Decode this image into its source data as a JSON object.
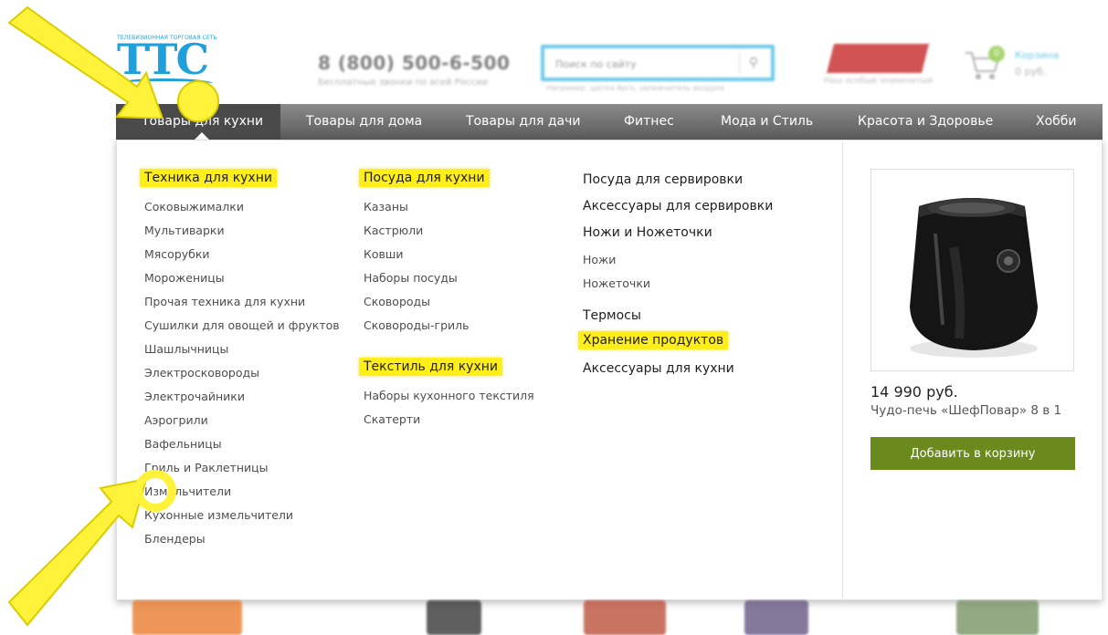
{
  "header": {
    "logo_tagline": "ТЕЛЕВИЗИОННАЯ ТОРГОВАЯ СЕТЬ",
    "logo_text": "ТТС",
    "phone": "8 (800) 500-6-500",
    "phone_note": "Бесплатные звонки по всей России",
    "search_placeholder": "Поиск по сайту",
    "search_example": "Например: щетка Арго, увлажнитель воздуха",
    "promo_note": "Наш особый знаменитый",
    "cart_label": "Корзина",
    "cart_count": "0",
    "cart_sum": "0 руб."
  },
  "nav": {
    "items": [
      {
        "label": "Товары для кухни"
      },
      {
        "label": "Товары для дома"
      },
      {
        "label": "Товары для дачи"
      },
      {
        "label": "Фитнес"
      },
      {
        "label": "Мода и Стиль"
      },
      {
        "label": "Красота и Здоровье"
      },
      {
        "label": "Хобби"
      }
    ]
  },
  "menu": {
    "col1": {
      "heading": "Техника для кухни",
      "links": [
        "Соковыжималки",
        "Мультиварки",
        "Мясорубки",
        "Мороженицы",
        "Прочая техника для кухни",
        "Сушилки для овощей и фруктов",
        "Шашлычницы",
        "Электросковороды",
        "Электрочайники",
        "Аэрогрили",
        "Вафельницы",
        "Гриль и Раклетницы",
        "Измельчители",
        "Кухонные измельчители",
        "Блендеры"
      ]
    },
    "col2": {
      "heading1": "Посуда для кухни",
      "links1": [
        "Казаны",
        "Кастрюли",
        "Ковши",
        "Наборы посуды",
        "Сковороды",
        "Сковороды-гриль"
      ],
      "heading2": "Текстиль для кухни",
      "links2": [
        "Наборы кухонного текстиля",
        "Скатерти"
      ]
    },
    "col3": {
      "items": [
        "Посуда для сервировки",
        "Аксессуары для сервировки",
        "Ножи и Ножеточки"
      ],
      "sublinks": [
        "Ножи",
        "Ножеточки"
      ],
      "item_thermos": "Термосы",
      "heading_storage": "Хранение продуктов",
      "item_accessories": "Аксессуары для кухни"
    }
  },
  "product": {
    "price": "14 990 руб.",
    "name": "Чудо-печь «ШефПовар» 8 в 1",
    "button": "Добавить в корзину"
  },
  "colors": {
    "highlight": "#ffee1a",
    "accent_blue": "#1ea0dd",
    "buy_button": "#6a8a1e",
    "nav_bg": "#6e6e6e"
  }
}
